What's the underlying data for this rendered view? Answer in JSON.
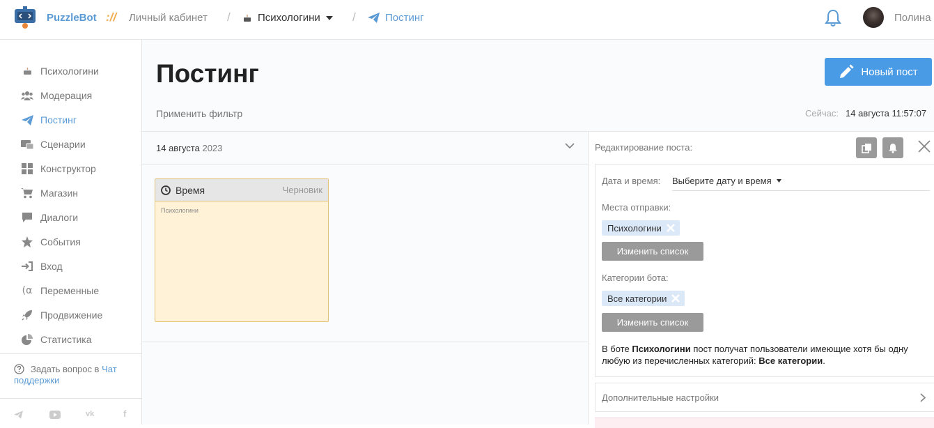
{
  "header": {
    "brand": "PuzzleBot",
    "brand_sep": "://",
    "crumb_cabinet": "Личный кабинет",
    "slash": "/",
    "crumb_bot": "Психологини",
    "crumb_posting": "Постинг",
    "user_name": "Полина"
  },
  "sidebar": {
    "items": [
      {
        "label": "Психологини",
        "icon": "cake-icon"
      },
      {
        "label": "Модерация",
        "icon": "users-icon"
      },
      {
        "label": "Постинг",
        "icon": "paper-plane-icon"
      },
      {
        "label": "Сценарии",
        "icon": "scenario-icon"
      },
      {
        "label": "Конструктор",
        "icon": "grid-icon"
      },
      {
        "label": "Магазин",
        "icon": "cart-icon"
      },
      {
        "label": "Диалоги",
        "icon": "chat-icon"
      },
      {
        "label": "События",
        "icon": "star-icon"
      },
      {
        "label": "Вход",
        "icon": "sign-in-icon"
      },
      {
        "label": "Переменные",
        "icon": "variable-icon"
      },
      {
        "label": "Продвижение",
        "icon": "rocket-icon"
      },
      {
        "label": "Статистика",
        "icon": "pie-chart-icon"
      }
    ],
    "active": "Постинг",
    "help_text": "Задать вопрос в",
    "help_link": "Чат поддержки",
    "social": [
      "telegram-icon",
      "youtube-icon",
      "vk-icon",
      "facebook-icon"
    ]
  },
  "main": {
    "title": "Постинг",
    "new_post_label": "Новый пост",
    "filter_label": "Применить фильтр",
    "now_label": "Сейчас:",
    "now_value": "14 августа 11:57:07",
    "date_day": "14 августа",
    "date_year": "2023",
    "card": {
      "time_label": "Время",
      "status": "Черновик",
      "body": "Психологини"
    }
  },
  "editor": {
    "title": "Редактирование поста:",
    "datetime_label": "Дата и время:",
    "datetime_value": "Выберите дату и время",
    "places_label": "Места отправки:",
    "places_tag": "Психологини",
    "change_list_label": "Изменить список",
    "categories_label": "Категории бота:",
    "categories_tag": "Все категории",
    "note_prefix": "В боте",
    "note_bot": "Психологини",
    "note_middle": "пост получат пользователи имеющие хотя бы одну любую из перечисленных категорий:",
    "note_categories": "Все категории",
    "note_end": ".",
    "extra_settings_label": "Дополнительные настройки"
  },
  "colors": {
    "accent": "#5b9bd5",
    "button": "#4a9be6",
    "card_bg": "#fff2d6",
    "tag_bg": "#dbe8f8"
  }
}
